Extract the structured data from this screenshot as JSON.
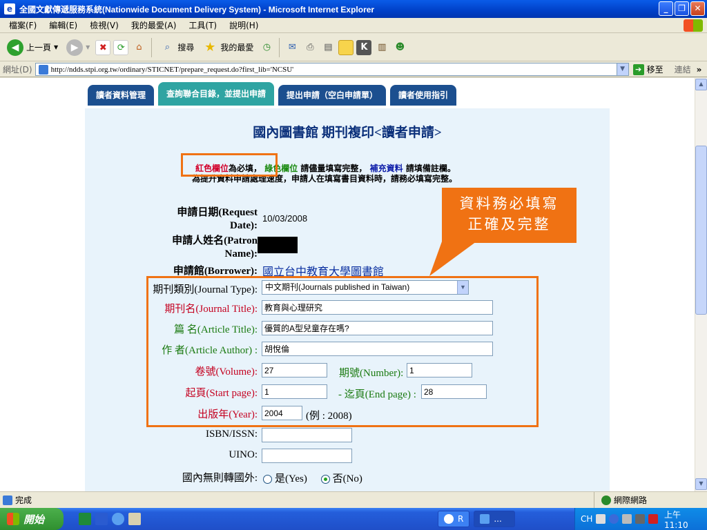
{
  "window": {
    "title": "全國文獻傳遞服務系統(Nationwide Document Delivery System) - Microsoft Internet Explorer",
    "minimize": "_",
    "restore": "❐",
    "close": "✕"
  },
  "menu": [
    "檔案(F)",
    "編輯(E)",
    "檢視(V)",
    "我的最愛(A)",
    "工具(T)",
    "說明(H)"
  ],
  "toolbar": {
    "back_label": "上一頁",
    "search_label": "搜尋",
    "favorites_label": "我的最愛"
  },
  "address": {
    "label": "網址(D)",
    "url": "http://ndds.stpi.org.tw/ordinary/STICNET/prepare_request.do?first_lib='NCSU'",
    "go_label": "移至",
    "links_label": "連結"
  },
  "tabs": [
    {
      "label": "讀者資料管理",
      "active": false
    },
    {
      "label": "查詢聯合目錄，並提出申請",
      "active": true
    },
    {
      "label": "提出申請（空白申請單）",
      "active": false
    },
    {
      "label": "讀者使用指引",
      "active": false
    }
  ],
  "page": {
    "title": "國內圖書館 期刊複印<讀者申請>",
    "notice": {
      "red_text": "紅色欄位",
      "required_text": "為必填，",
      "green_text": "綠色欄位",
      "fill_text": "請儘量填寫完整，",
      "blue_text": "補充資料",
      "remark_text": "請填備註欄。",
      "line2": "為提升資料申請處理速度，申請人在填寫書目資料時，請務必填寫完整。"
    },
    "request_date": {
      "label_line1": "申請日期(Request",
      "label_line2": "Date):",
      "value": "10/03/2008"
    },
    "patron_name": {
      "label_line1": "申請人姓名(Patron",
      "label_line2": "Name):"
    },
    "borrower": {
      "label": "申請館(Borrower):",
      "value": "國立台中教育大學圖書館"
    },
    "journal_type": {
      "label": "期刊類別(Journal Type):",
      "value": "中文期刊(Journals published in Taiwan)"
    },
    "journal_title": {
      "label": "期刊名(Journal Title):",
      "value": "教育與心理研究"
    },
    "article_title": {
      "label": "篇 名(Article Title):",
      "value": "優質的A型兒童存在嗎?"
    },
    "article_author": {
      "label": "作 者(Article Author) :",
      "value": "胡悅倫"
    },
    "volume": {
      "label": "卷號(Volume):",
      "value": "27"
    },
    "number": {
      "label": "期號(Number):",
      "value": "1"
    },
    "start_page": {
      "label": "起頁(Start page):",
      "value": "1"
    },
    "end_page": {
      "label": "- 迄頁(End page) :",
      "value": "28"
    },
    "year": {
      "label": "出版年(Year):",
      "value": "2004",
      "example": "(例 : 2008)"
    },
    "isbn": {
      "label": "ISBN/ISSN:",
      "value": ""
    },
    "uino": {
      "label": "UINO:",
      "value": ""
    },
    "transfer": {
      "label": "國內無則轉國外:",
      "yes": "是(Yes)",
      "no": "否(No)",
      "selected": "no"
    }
  },
  "annotation": {
    "line1": "資料務必填寫",
    "line2": "正確及完整",
    "color": "#f07213"
  },
  "status": {
    "left": "完成",
    "right": "網際網路"
  },
  "taskbar": {
    "start": "開始",
    "task1": "R",
    "task2": "...",
    "lang": "CH",
    "clock": "上午 11:10"
  }
}
